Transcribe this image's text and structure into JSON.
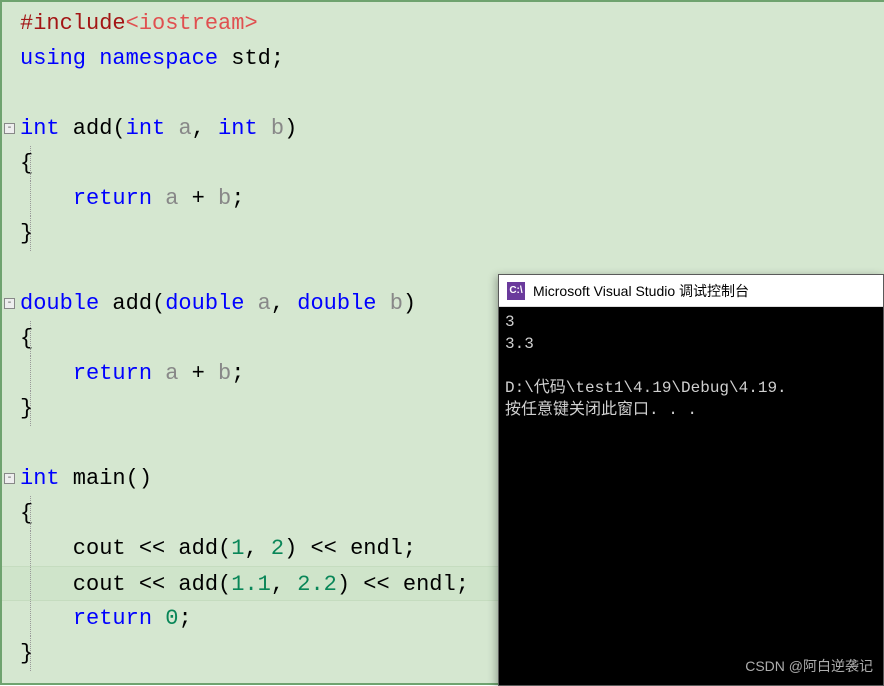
{
  "code": {
    "lines": [
      {
        "tokens": [
          {
            "cls": "kw-red",
            "text": "#include"
          },
          {
            "cls": "kw-angle",
            "text": "<iostream>"
          }
        ]
      },
      {
        "tokens": [
          {
            "cls": "kw-blue",
            "text": "using"
          },
          {
            "cls": "ident",
            "text": " "
          },
          {
            "cls": "kw-blue",
            "text": "namespace"
          },
          {
            "cls": "ident",
            "text": " std"
          },
          {
            "cls": "semi",
            "text": ";"
          }
        ]
      },
      {
        "tokens": []
      },
      {
        "fold": true,
        "tokens": [
          {
            "cls": "kw-blue",
            "text": "int"
          },
          {
            "cls": "ident",
            "text": " add"
          },
          {
            "cls": "operator",
            "text": "("
          },
          {
            "cls": "kw-blue",
            "text": "int"
          },
          {
            "cls": "ident",
            "text": " "
          },
          {
            "cls": "param",
            "text": "a"
          },
          {
            "cls": "operator",
            "text": ", "
          },
          {
            "cls": "kw-blue",
            "text": "int"
          },
          {
            "cls": "ident",
            "text": " "
          },
          {
            "cls": "param",
            "text": "b"
          },
          {
            "cls": "operator",
            "text": ")"
          }
        ]
      },
      {
        "guide": true,
        "tokens": [
          {
            "cls": "operator",
            "text": "{"
          }
        ]
      },
      {
        "guide": true,
        "tokens": [
          {
            "cls": "ident",
            "text": "    "
          },
          {
            "cls": "kw-blue",
            "text": "return"
          },
          {
            "cls": "ident",
            "text": " "
          },
          {
            "cls": "param",
            "text": "a"
          },
          {
            "cls": "operator",
            "text": " + "
          },
          {
            "cls": "param",
            "text": "b"
          },
          {
            "cls": "semi",
            "text": ";"
          }
        ]
      },
      {
        "guide": true,
        "tokens": [
          {
            "cls": "operator",
            "text": "}"
          }
        ]
      },
      {
        "tokens": []
      },
      {
        "fold": true,
        "tokens": [
          {
            "cls": "kw-blue",
            "text": "double"
          },
          {
            "cls": "ident",
            "text": " add"
          },
          {
            "cls": "operator",
            "text": "("
          },
          {
            "cls": "kw-blue",
            "text": "double"
          },
          {
            "cls": "ident",
            "text": " "
          },
          {
            "cls": "param",
            "text": "a"
          },
          {
            "cls": "operator",
            "text": ", "
          },
          {
            "cls": "kw-blue",
            "text": "double"
          },
          {
            "cls": "ident",
            "text": " "
          },
          {
            "cls": "param",
            "text": "b"
          },
          {
            "cls": "operator",
            "text": ")"
          }
        ]
      },
      {
        "guide": true,
        "tokens": [
          {
            "cls": "operator",
            "text": "{"
          }
        ]
      },
      {
        "guide": true,
        "tokens": [
          {
            "cls": "ident",
            "text": "    "
          },
          {
            "cls": "kw-blue",
            "text": "return"
          },
          {
            "cls": "ident",
            "text": " "
          },
          {
            "cls": "param",
            "text": "a"
          },
          {
            "cls": "operator",
            "text": " + "
          },
          {
            "cls": "param",
            "text": "b"
          },
          {
            "cls": "semi",
            "text": ";"
          }
        ]
      },
      {
        "guide": true,
        "tokens": [
          {
            "cls": "operator",
            "text": "}"
          }
        ]
      },
      {
        "tokens": []
      },
      {
        "fold": true,
        "tokens": [
          {
            "cls": "kw-blue",
            "text": "int"
          },
          {
            "cls": "ident",
            "text": " main"
          },
          {
            "cls": "operator",
            "text": "()"
          }
        ]
      },
      {
        "guide": true,
        "tokens": [
          {
            "cls": "operator",
            "text": "{"
          }
        ]
      },
      {
        "guide": true,
        "tokens": [
          {
            "cls": "ident",
            "text": "    cout "
          },
          {
            "cls": "operator",
            "text": "<<"
          },
          {
            "cls": "ident",
            "text": " add"
          },
          {
            "cls": "operator",
            "text": "("
          },
          {
            "cls": "number",
            "text": "1"
          },
          {
            "cls": "operator",
            "text": ", "
          },
          {
            "cls": "number",
            "text": "2"
          },
          {
            "cls": "operator",
            "text": ") "
          },
          {
            "cls": "operator",
            "text": "<<"
          },
          {
            "cls": "ident",
            "text": " endl"
          },
          {
            "cls": "semi",
            "text": ";"
          }
        ]
      },
      {
        "guide": true,
        "highlight": true,
        "tokens": [
          {
            "cls": "ident",
            "text": "    cout "
          },
          {
            "cls": "operator",
            "text": "<<"
          },
          {
            "cls": "ident",
            "text": " add"
          },
          {
            "cls": "operator",
            "text": "("
          },
          {
            "cls": "number",
            "text": "1.1"
          },
          {
            "cls": "operator",
            "text": ", "
          },
          {
            "cls": "number",
            "text": "2.2"
          },
          {
            "cls": "operator",
            "text": ") "
          },
          {
            "cls": "operator",
            "text": "<<"
          },
          {
            "cls": "ident",
            "text": " endl"
          },
          {
            "cls": "semi",
            "text": ";"
          }
        ]
      },
      {
        "guide": true,
        "tokens": [
          {
            "cls": "ident",
            "text": "    "
          },
          {
            "cls": "kw-blue",
            "text": "return"
          },
          {
            "cls": "ident",
            "text": " "
          },
          {
            "cls": "number",
            "text": "0"
          },
          {
            "cls": "semi",
            "text": ";"
          }
        ]
      },
      {
        "guide": true,
        "tokens": [
          {
            "cls": "operator",
            "text": "}"
          }
        ]
      }
    ]
  },
  "console": {
    "icon_text": "C:\\",
    "title": "Microsoft Visual Studio 调试控制台",
    "output_line1": "3",
    "output_line2": "3.3",
    "output_blank": "",
    "output_path": "D:\\代码\\test1\\4.19\\Debug\\4.19.",
    "output_prompt": "按任意键关闭此窗口. . ."
  },
  "watermark": "CSDN @阿白逆袭记",
  "fold_glyph": "⊟"
}
